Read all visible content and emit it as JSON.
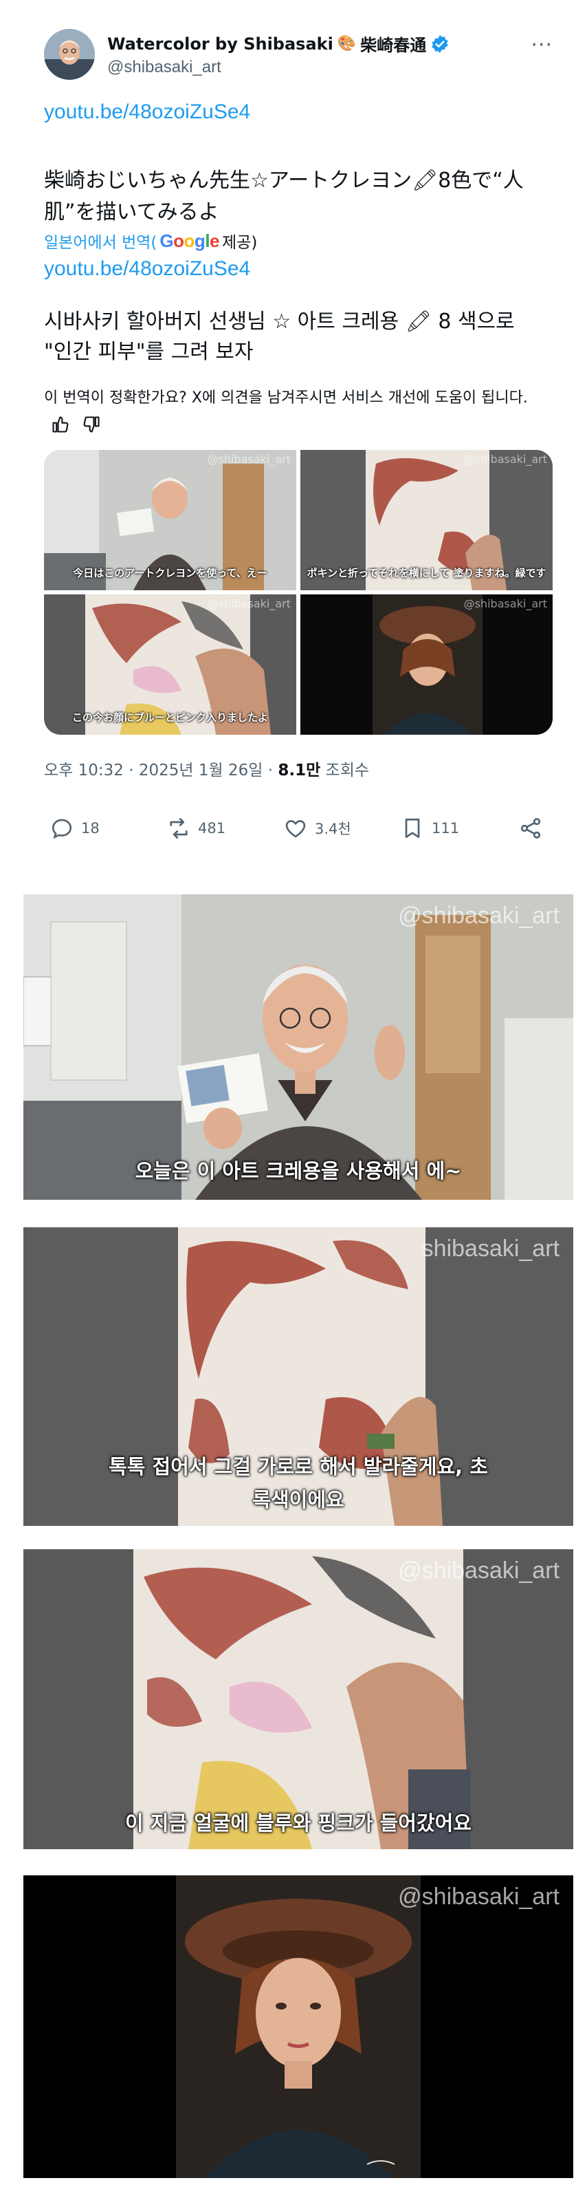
{
  "author": {
    "name": "Watercolor by Shibasaki",
    "name_jp": "柴崎春通",
    "handle": "@shibasaki_art",
    "palette_emoji": "🎨",
    "verified_color": "#1d9bf0"
  },
  "more_label": "···",
  "post": {
    "link_1": "youtu.be/48ozoiZuSe4",
    "text_jp": "柴崎おじいちゃん先生☆アートクレヨン🖍8色で“人肌”を描いてみるよ",
    "translated_prefix": "일본어에서 번역(",
    "translated_brand": "Google",
    "translated_suffix": " 제공)",
    "link_2": "youtu.be/48ozoiZuSe4",
    "text_ko": "시바사키 할아버지 선생님 ☆ 아트 크레용 🖍 8 색으로 \"인간 피부\"를 그려 보자",
    "feedback": "이 번역이 정확한가요? X에 의견을 남겨주시면 서비스 개선에 도움이 됩니다."
  },
  "thumbnails": [
    {
      "caption": "今日はこのアートクレヨンを使って、えー",
      "watermark": "@shibasaki_art"
    },
    {
      "caption": "ポキンと折ってそれを横にして 塗りますね。緑です",
      "watermark": "@shibasaki_art"
    },
    {
      "caption": "この今お顔にブルーとピンク入りましたよ",
      "watermark": "@shibasaki_art"
    },
    {
      "caption": "",
      "watermark": "@shibasaki_art"
    }
  ],
  "meta": {
    "time": "오후 10:32 · 2025년 1월 26일 · ",
    "views": "8.1만",
    "views_label": " 조회수"
  },
  "actions": {
    "replies": "18",
    "reposts": "481",
    "likes": "3.4천",
    "bookmarks": "111"
  },
  "panels": [
    {
      "caption": "오늘은 이 아트 크레용을 사용해서 에~",
      "watermark": "@shibasaki_art"
    },
    {
      "caption": "톡톡 접어서 그걸 가로로 해서 발라줄게요, 초록색이에요",
      "watermark": "shibasaki_art"
    },
    {
      "caption": "이 지금 얼굴에 블루와 핑크가 들어갔어요",
      "watermark": "@shibasaki_art"
    },
    {
      "caption": "",
      "watermark": "@shibasaki_art"
    }
  ],
  "colors": {
    "link": "#1d9bf0",
    "muted": "#536471",
    "text": "#0f1419",
    "crayon_red": "#a8483a"
  }
}
